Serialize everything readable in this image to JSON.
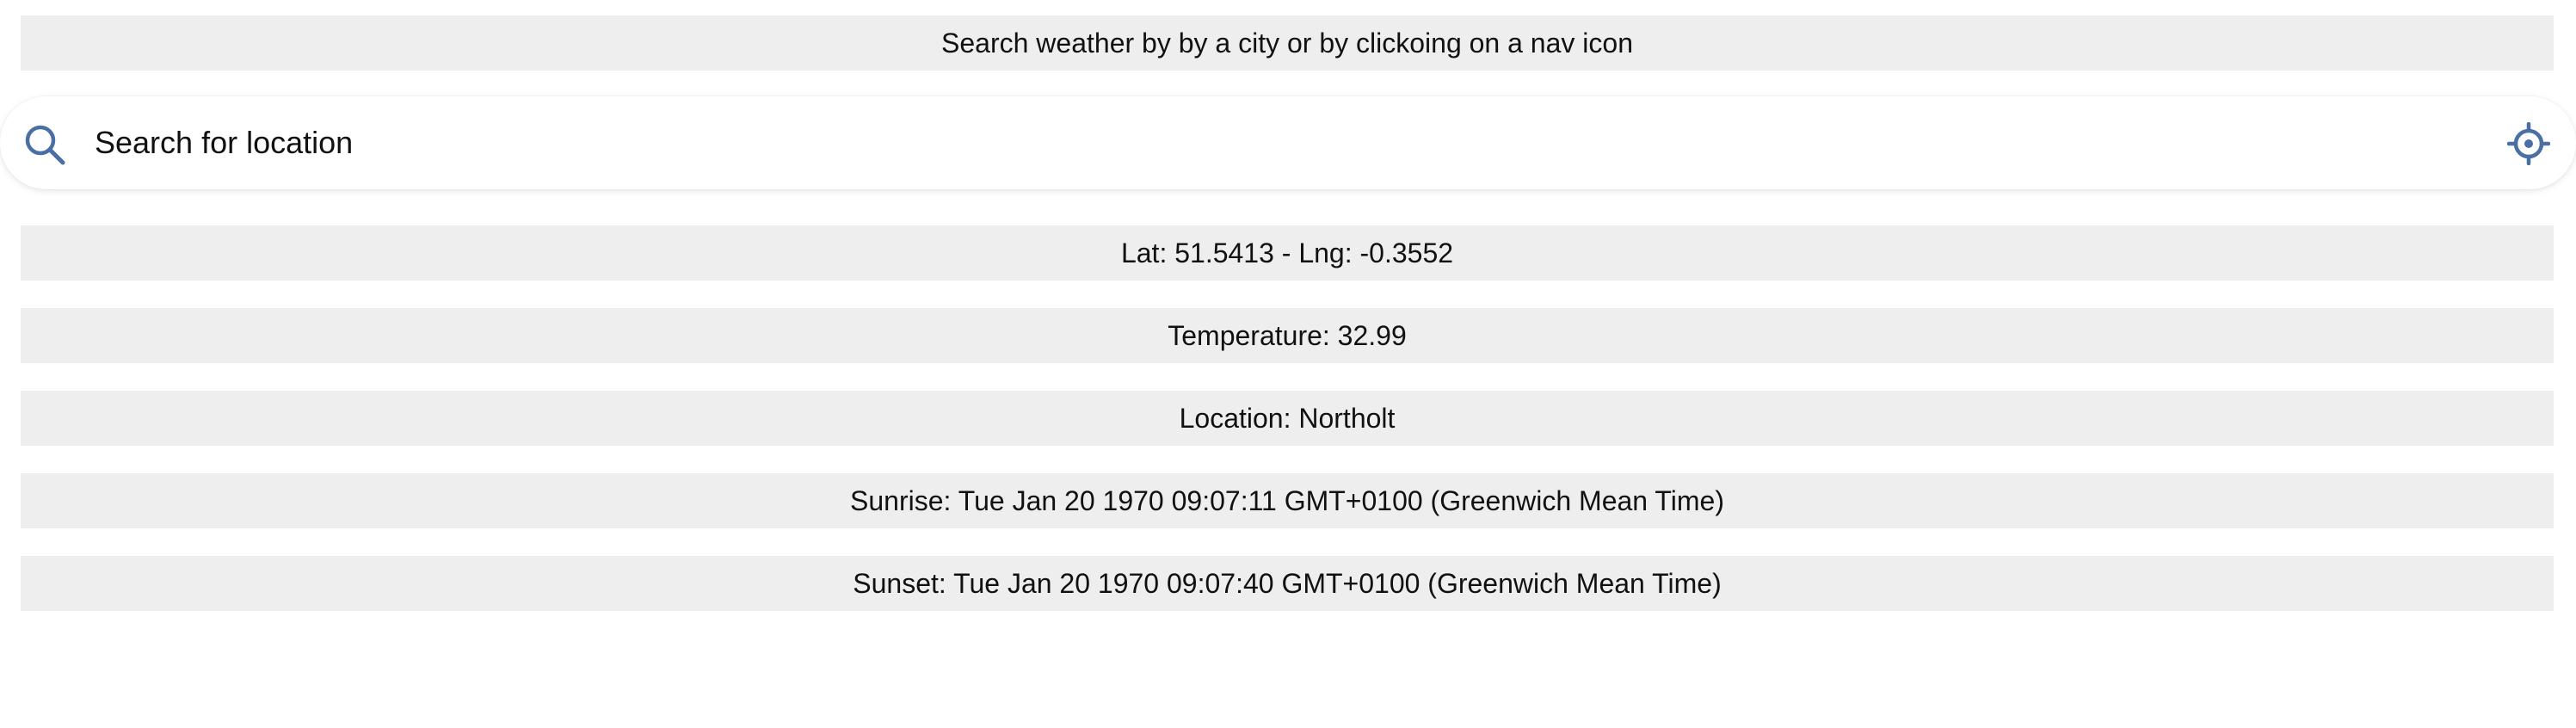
{
  "header": {
    "instruction": "Search weather by by a city or by clickoing on a nav icon"
  },
  "search": {
    "placeholder": "Search for location",
    "value": "",
    "search_icon": "search-icon",
    "locate_icon": "crosshair-icon"
  },
  "weather": {
    "coordinates": "Lat: 51.5413 - Lng: -0.3552",
    "temperature": "Temperature: 32.99",
    "location": "Location: Northolt",
    "sunrise": "Sunrise: Tue Jan 20 1970 09:07:11 GMT+0100 (Greenwich Mean Time)",
    "sunset": "Sunset: Tue Jan 20 1970 09:07:40 GMT+0100 (Greenwich Mean Time)"
  },
  "colors": {
    "banner_background": "#eeeeee",
    "icon_accent": "#4a6fa5",
    "text": "#111111"
  }
}
